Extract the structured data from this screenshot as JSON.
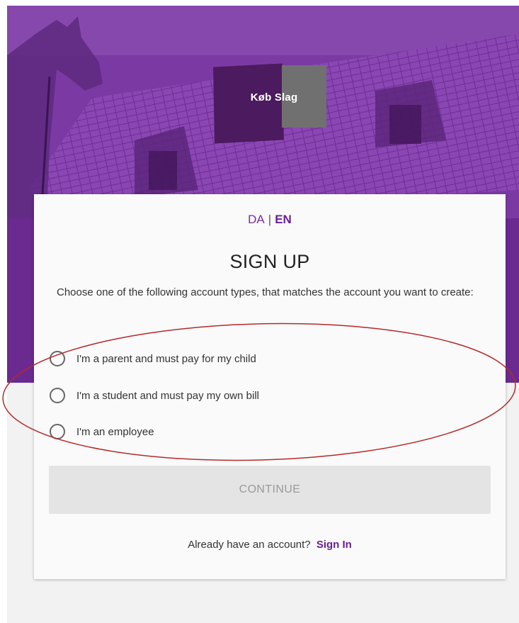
{
  "logo": {
    "text_left": "Køb",
    "text_right": "Slag"
  },
  "language": {
    "da": "DA",
    "separator": "|",
    "en": "EN"
  },
  "title": "SIGN UP",
  "instructions": "Choose one of the following account types, that matches the account you want to create:",
  "account_types": [
    {
      "label": "I'm a parent and must pay for my child",
      "selected": false
    },
    {
      "label": "I'm a student and must pay my own bill",
      "selected": false
    },
    {
      "label": "I'm an employee",
      "selected": false
    }
  ],
  "continue_label": "CONTINUE",
  "signin": {
    "prompt": "Already have an account?",
    "link": "Sign In"
  },
  "colors": {
    "brand_purple": "#7d3aa6",
    "logo_dark": "#4c1a5e",
    "logo_gray": "#707070",
    "annotation_red": "#b52a2a"
  }
}
